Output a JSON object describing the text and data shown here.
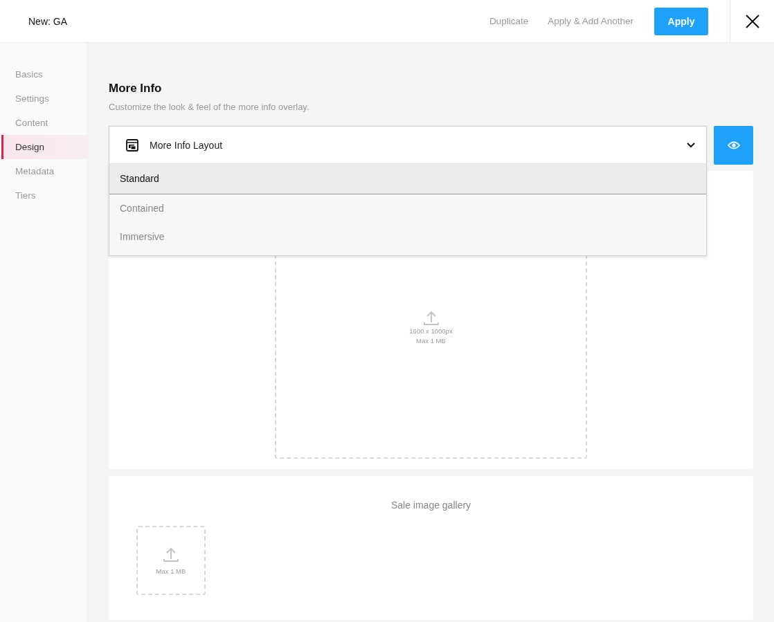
{
  "header": {
    "title": "New: GA",
    "actions": [
      {
        "label": "Duplicate",
        "kind": "link"
      },
      {
        "label": "Apply & Add Another",
        "kind": "link"
      },
      {
        "label": "Apply",
        "kind": "primary"
      }
    ]
  },
  "sidebar": {
    "items": [
      {
        "label": "Basics",
        "selected": false
      },
      {
        "label": "Settings",
        "selected": false
      },
      {
        "label": "Content",
        "selected": false
      },
      {
        "label": "Design",
        "selected": true
      },
      {
        "label": "Metadata",
        "selected": false
      },
      {
        "label": "Tiers",
        "selected": false
      }
    ]
  },
  "section": {
    "title": "More Info",
    "subtitle": "Customize the look & feel of the more info overlay."
  },
  "layout_select": {
    "label": "More Info Layout",
    "expanded": true,
    "options": [
      {
        "label": "Standard",
        "selected": true
      },
      {
        "label": "Contained",
        "selected": false
      },
      {
        "label": "Immersive",
        "selected": false
      }
    ]
  },
  "cover_upload": {
    "size": "1600 x 1000px",
    "limit": "Max 1 MB"
  },
  "gallery": {
    "title": "Sale image gallery",
    "upload": {
      "limit": "Max 1 MB"
    }
  }
}
